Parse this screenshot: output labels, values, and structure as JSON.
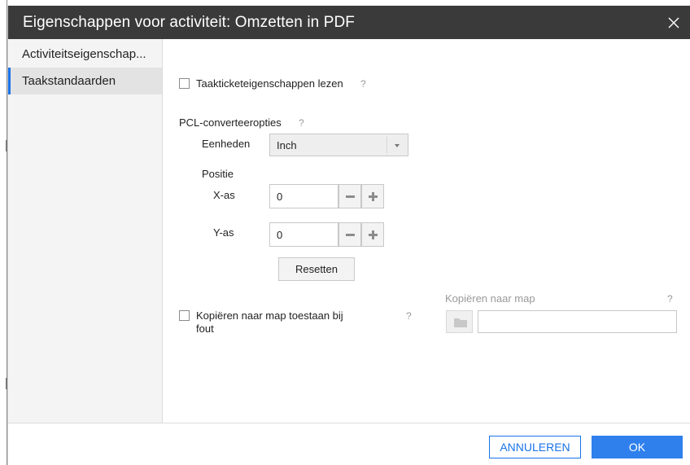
{
  "dialog": {
    "title": "Eigenschappen voor activiteit: Omzetten in PDF"
  },
  "sidebar": {
    "items": [
      {
        "label": "Activiteitseigenschap...",
        "active": false
      },
      {
        "label": "Taakstandaarden",
        "active": true
      }
    ]
  },
  "content": {
    "read_ticket": {
      "label": "Taakticketeigenschappen lezen",
      "checked": false,
      "help": "?"
    },
    "pcl": {
      "heading": "PCL-converteeropties",
      "help": "?",
      "units_label": "Eenheden",
      "units_value": "Inch",
      "position_label": "Positie",
      "x_label": "X-as",
      "x_value": "0",
      "y_label": "Y-as",
      "y_value": "0",
      "reset_label": "Resetten"
    },
    "copy_on_error": {
      "label_line1": "Kopiëren naar map toestaan bij",
      "label_line2": "fout",
      "checked": false,
      "help": "?"
    },
    "copy_folder": {
      "label": "Kopiëren naar map",
      "help": "?",
      "value": ""
    }
  },
  "footer": {
    "cancel_label": "ANNULEREN",
    "ok_label": "OK"
  },
  "colors": {
    "titlebar": "#3a3a3a",
    "accent": "#2f80ed",
    "sidebar_bg": "#f4f4f4"
  },
  "icons": [
    "close-icon",
    "chevron-down-icon",
    "minus-icon",
    "plus-icon",
    "folder-icon"
  ]
}
